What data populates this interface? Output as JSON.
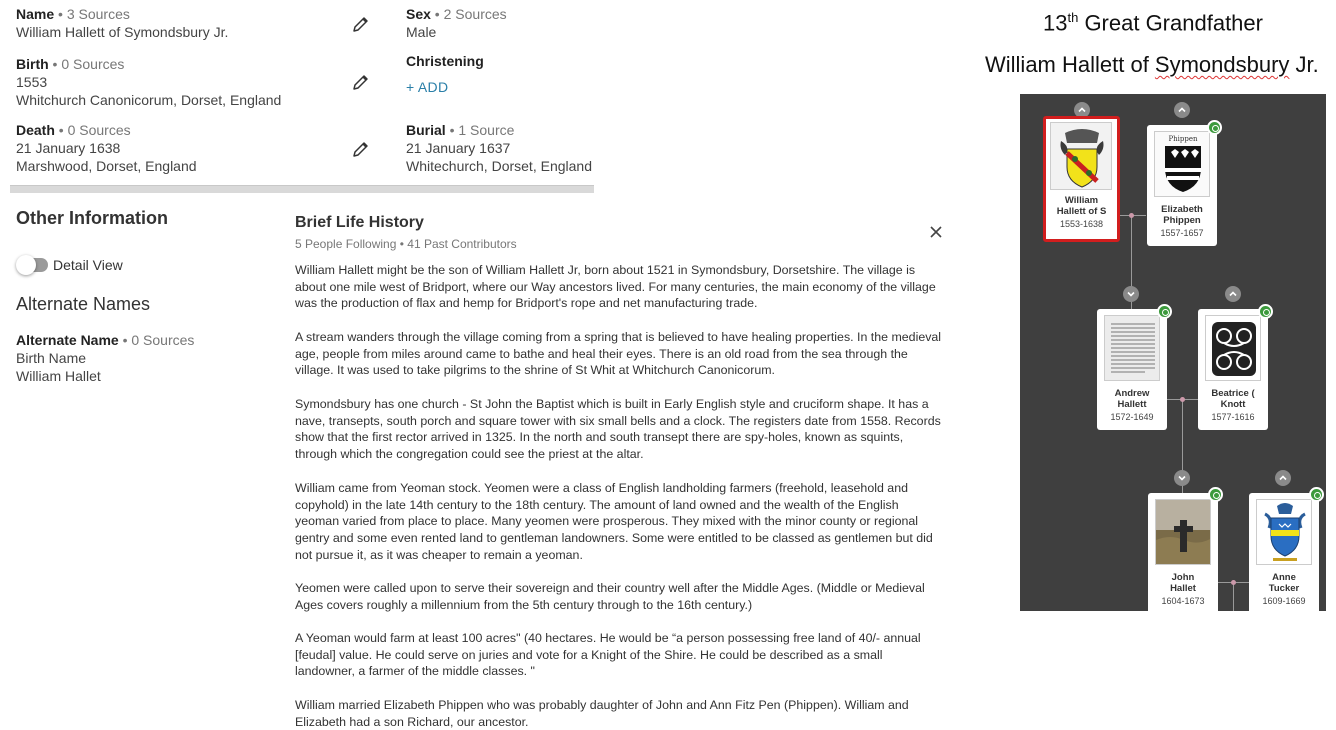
{
  "vitals": {
    "name": {
      "label": "Name",
      "sources": " • 3 Sources",
      "value": "William Hallett of Symondsbury Jr."
    },
    "sex": {
      "label": "Sex",
      "sources": " • 2 Sources",
      "value": "Male"
    },
    "birth": {
      "label": "Birth",
      "sources": " • 0 Sources",
      "date": "1553",
      "place": "Whitchurch Canonicorum, Dorset, England"
    },
    "christening": {
      "label": "Christening",
      "add_label": "+  ADD"
    },
    "death": {
      "label": "Death",
      "sources": " • 0 Sources",
      "date": "21 January 1638",
      "place": "Marshwood, Dorset, England"
    },
    "burial": {
      "label": "Burial",
      "sources": " • 1 Source",
      "date": "21 January 1637",
      "place": "Whitechurch, Dorset, England"
    }
  },
  "other_info": {
    "title": "Other Information",
    "detail_view_label": "Detail View",
    "alternate_names_title": "Alternate Names",
    "alternate_name": {
      "label": "Alternate Name",
      "sources": " • 0 Sources",
      "type": "Birth Name",
      "value": "William Hallet"
    }
  },
  "life_history": {
    "title": "Brief Life History",
    "subtitle": "5 People Following • 41 Past Contributors",
    "paragraphs": [
      "William Hallett might be the son of William Hallett Jr, born about 1521 in Symondsbury, Dorsetshire. The village is about one mile west of Bridport, where our Way ancestors lived. For many centuries, the main economy of the village was the production of flax and hemp for Bridport's rope and net manufacturing trade.",
      "A stream wanders through the village coming from a spring that is believed to have healing properties. In the medieval age, people from miles around came to bathe and heal their eyes. There is an old road from the sea through the village. It was used to take pilgrims to the shrine of St Whit at Whitchurch Canonicorum.",
      "Symondsbury has one church - St John the Baptist which is built in Early English style and cruciform shape. It has a nave, transepts, south porch and square tower with six small bells and a clock. The registers date from 1558. Records show that the first rector arrived in 1325. In the north and south transept there are spy-holes, known as squints, through which the congregation could see the priest at the altar.",
      "William came from Yeoman stock.  Yeomen were a class of English landholding farmers (freehold, leasehold and copyhold) in the late 14th century to the 18th century. The amount of land owned and the wealth of the English yeoman varied from place to place. Many yeomen were prosperous. They mixed with the minor county or regional gentry and some even rented land to gentleman landowners. Some were entitled to be classed as gentlemen but did not pursue it, as it was cheaper to remain a yeoman.",
      "Yeomen were called upon to serve their sovereign and their country well after the Middle Ages. (Middle or Medieval Ages covers roughly a millennium from the 5th century through to the 16th century.)",
      "A Yeoman would farm at least 100 acres\" (40 hectares.   He would be “a person possessing free land of 40/- annual [feudal] value. He could serve on juries and vote for a Knight of the Shire. He could be described as a small landowner, a farmer of the middle classes.  \"",
      "William married Elizabeth Phippen who was probably  daughter of John and Ann Fitz Pen (Phippen). William and Elizabeth had a son Richard, our ancestor."
    ]
  },
  "header": {
    "generation_num": "13",
    "generation_sup": "th",
    "generation_rest": " Great Grandfather",
    "name_pre": "William Hallett of ",
    "name_squiggle": "Symondsbury",
    "name_post": " Jr."
  },
  "tree": {
    "cards": [
      {
        "name1": "William",
        "name2": "Hallett of S",
        "years": "1553-1638"
      },
      {
        "name1": "Elizabeth",
        "name2": "Phippen",
        "years": "1557-1657"
      },
      {
        "name1": "Andrew",
        "name2": "Hallett",
        "years": "1572-1649"
      },
      {
        "name1": "Beatrice (",
        "name2": "Knott",
        "years": "1577-1616"
      },
      {
        "name1": "John",
        "name2": "Hallet",
        "years": "1604-1673"
      },
      {
        "name1": "Anne",
        "name2": "Tucker",
        "years": "1609-1669"
      }
    ]
  },
  "colors": {
    "accent": "#2a7fa8",
    "selected_border": "#d21e1e",
    "tree_bg": "#3f3f3f",
    "badge": "#3c9a3c"
  }
}
